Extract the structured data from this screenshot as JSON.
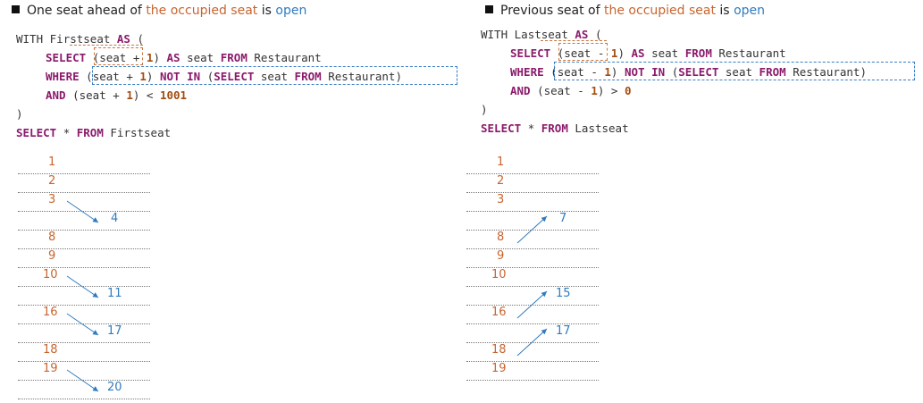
{
  "left": {
    "heading": {
      "pre": "One seat ahead of ",
      "highlight": "the occupied seat",
      "mid": " is ",
      "status": "open"
    },
    "code": {
      "l1": {
        "kw": "WITH",
        "name": "Firstseat",
        "as": "AS",
        "paren": "("
      },
      "l2": {
        "kw": "SELECT",
        "expr_open": "(seat",
        "op": "+",
        "one": "1",
        "expr_close": ")",
        "as": "AS",
        "alias": "seat",
        "from": "FROM",
        "table": "Restaurant"
      },
      "l3": {
        "kw": "WHERE",
        "expr_open": "(seat + ",
        "one": "1",
        "expr_close": ")",
        "not": "NOT",
        "in": "IN",
        "sub_open": "(",
        "select": "SELECT",
        "col": "seat",
        "from": "FROM",
        "table": "Restaurant",
        "sub_close": ")"
      },
      "l4": {
        "kw": "AND",
        "expr_open": "(seat + ",
        "one": "1",
        "expr_close": ") < ",
        "limit": "1001"
      },
      "l5": ")",
      "l6": {
        "select": "SELECT",
        "star": "*",
        "from": "FROM",
        "table": "Firstseat"
      }
    },
    "rows": [
      {
        "occupied": "1",
        "result": ""
      },
      {
        "occupied": "2",
        "result": ""
      },
      {
        "occupied": "3",
        "result": ""
      },
      {
        "occupied": "",
        "result": "4"
      },
      {
        "occupied": "8",
        "result": ""
      },
      {
        "occupied": "9",
        "result": ""
      },
      {
        "occupied": "10",
        "result": ""
      },
      {
        "occupied": "",
        "result": "11"
      },
      {
        "occupied": "16",
        "result": ""
      },
      {
        "occupied": "",
        "result": "17"
      },
      {
        "occupied": "18",
        "result": ""
      },
      {
        "occupied": "19",
        "result": ""
      },
      {
        "occupied": "",
        "result": "20"
      }
    ]
  },
  "right": {
    "heading": {
      "pre": "Previous seat of ",
      "highlight": "the occupied seat",
      "mid": " is ",
      "status": "open"
    },
    "code": {
      "l1": {
        "kw": "WITH",
        "name": "Lastseat",
        "as": "AS",
        "paren": "("
      },
      "l2": {
        "kw": "SELECT",
        "expr_open": "(seat",
        "op": "-",
        "one": "1",
        "expr_close": ")",
        "as": "AS",
        "alias": "seat",
        "from": "FROM",
        "table": "Restaurant"
      },
      "l3": {
        "kw": "WHERE",
        "expr_open": "(seat - ",
        "one": "1",
        "expr_close": ")",
        "not": "NOT",
        "in": "IN",
        "sub_open": "(",
        "select": "SELECT",
        "col": "seat",
        "from": "FROM",
        "table": "Restaurant",
        "sub_close": ")"
      },
      "l4": {
        "kw": "AND",
        "expr_open": "(seat - ",
        "one": "1",
        "expr_close": ") > ",
        "limit": "0"
      },
      "l5": ")",
      "l6": {
        "select": "SELECT",
        "star": "*",
        "from": "FROM",
        "table": "Lastseat"
      }
    },
    "rows": [
      {
        "occupied": "1",
        "result": ""
      },
      {
        "occupied": "2",
        "result": ""
      },
      {
        "occupied": "3",
        "result": ""
      },
      {
        "occupied": "",
        "result": "7"
      },
      {
        "occupied": "8",
        "result": ""
      },
      {
        "occupied": "9",
        "result": ""
      },
      {
        "occupied": "10",
        "result": ""
      },
      {
        "occupied": "",
        "result": "15"
      },
      {
        "occupied": "16",
        "result": ""
      },
      {
        "occupied": "",
        "result": "17"
      },
      {
        "occupied": "18",
        "result": ""
      },
      {
        "occupied": "19",
        "result": ""
      }
    ]
  },
  "colors": {
    "occupied": "#c7652f",
    "open": "#2f7bc0",
    "keyword": "#8b1a6b",
    "number": "#a24d10"
  }
}
